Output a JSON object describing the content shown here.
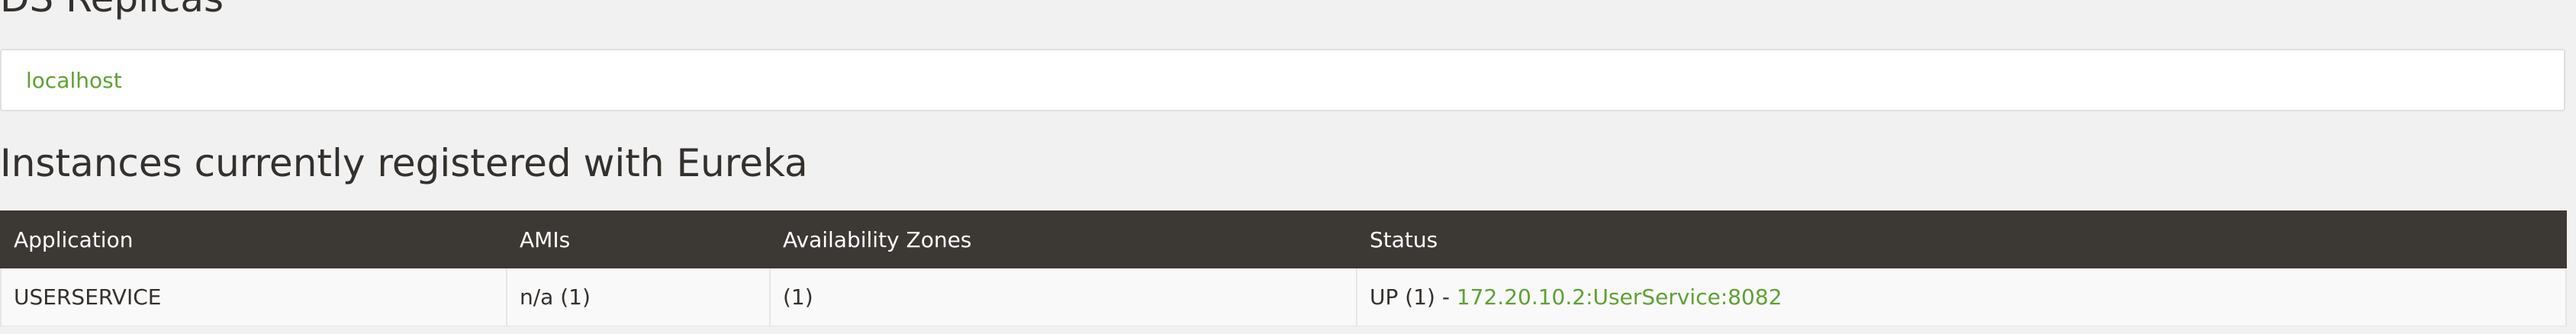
{
  "replicas": {
    "heading": "DS Replicas",
    "items": [
      {
        "label": "localhost"
      }
    ]
  },
  "instances": {
    "heading": "Instances currently registered with Eureka",
    "columns": [
      "Application",
      "AMIs",
      "Availability Zones",
      "Status"
    ],
    "rows": [
      {
        "application": "USERSERVICE",
        "amis": "n/a (1)",
        "availability_zones": "(1)",
        "status_prefix": "UP (1) - ",
        "status_link": "172.20.10.2:UserService:8082"
      }
    ]
  },
  "colors": {
    "background": "#f1f1f1",
    "table_header": "#3c3834",
    "link": "#5fa134",
    "text": "#34302d"
  }
}
